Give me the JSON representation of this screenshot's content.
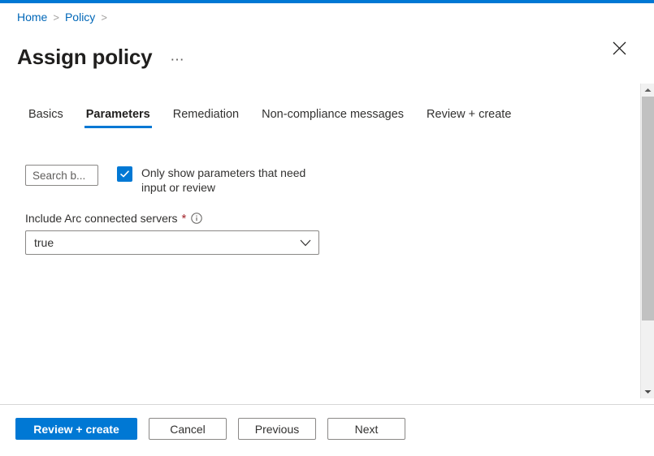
{
  "theme": {
    "accent": "#0078d4",
    "link": "#0067b8",
    "required": "#a4262c",
    "text": "#323130"
  },
  "breadcrumb": {
    "items": [
      {
        "label": "Home",
        "separator": ">"
      },
      {
        "label": "Policy",
        "separator": ">"
      }
    ]
  },
  "header": {
    "title": "Assign policy",
    "more_label": "⋯",
    "close_label": "Close"
  },
  "tabs": [
    {
      "label": "Basics",
      "active": false
    },
    {
      "label": "Parameters",
      "active": true
    },
    {
      "label": "Remediation",
      "active": false
    },
    {
      "label": "Non-compliance messages",
      "active": false
    },
    {
      "label": "Review + create",
      "active": false
    }
  ],
  "filters": {
    "search": {
      "value": "",
      "placeholder": "Search b..."
    },
    "only_needed": {
      "label": "Only show parameters that need input or review",
      "checked": true
    }
  },
  "parameters": [
    {
      "label": "Include Arc connected servers",
      "required_marker": "*",
      "info_icon": "info-icon",
      "value": "true"
    }
  ],
  "scrollbar": {
    "up_label": "▲",
    "down_label": "▼"
  },
  "footer": {
    "buttons": [
      {
        "label": "Review + create",
        "style": "primary"
      },
      {
        "label": "Cancel",
        "style": "default"
      },
      {
        "label": "Previous",
        "style": "default"
      },
      {
        "label": "Next",
        "style": "default"
      }
    ]
  }
}
